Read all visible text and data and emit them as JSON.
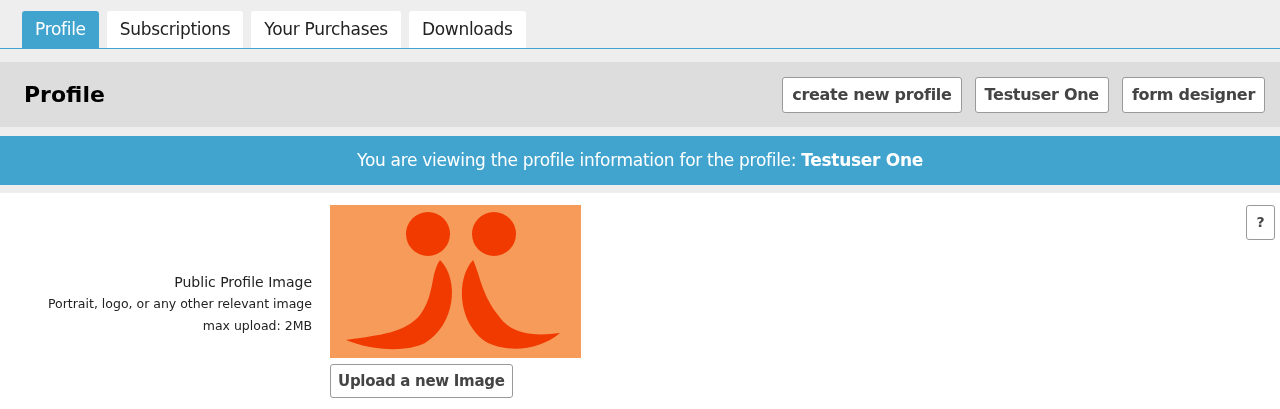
{
  "tabs": [
    {
      "label": "Profile",
      "selected": true
    },
    {
      "label": "Subscriptions",
      "selected": false
    },
    {
      "label": "Your Purchases",
      "selected": false
    },
    {
      "label": "Downloads",
      "selected": false
    }
  ],
  "header": {
    "title": "Profile",
    "buttons": [
      "create new profile",
      "Testuser One",
      "form designer"
    ]
  },
  "banner": "You are viewing the profile information for the profile: **Testuser One**",
  "help_button": "?",
  "image_field": {
    "label": "Public Profile Image",
    "hint": "Portrait, logo, or any other relevant image",
    "max_upload": "max upload: 2MB",
    "upload_button": "Upload a new Image"
  }
}
